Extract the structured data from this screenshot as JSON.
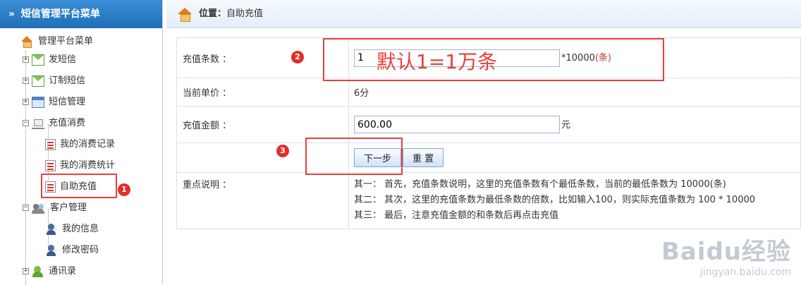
{
  "sidebar": {
    "header": "短信管理平台菜单",
    "chevron": "»",
    "root": "管理平台菜单",
    "items": [
      {
        "label": "发短信",
        "icon": "mail-icon",
        "toggle": "+"
      },
      {
        "label": "订制短信",
        "icon": "mail-icon",
        "toggle": "+"
      },
      {
        "label": "短信管理",
        "icon": "calendar-icon",
        "toggle": "+"
      },
      {
        "label": "充值消费",
        "icon": "cart-icon",
        "toggle": "−",
        "children": [
          {
            "label": "我的消费记录",
            "icon": "list-icon"
          },
          {
            "label": "我的消费统计",
            "icon": "list-icon"
          },
          {
            "label": "自助充值",
            "icon": "list-icon"
          }
        ]
      },
      {
        "label": "客户管理",
        "icon": "users-icon",
        "toggle": "−",
        "children": [
          {
            "label": "我的信息",
            "icon": "person-icon"
          },
          {
            "label": "修改密码",
            "icon": "person-icon"
          }
        ]
      },
      {
        "label": "通讯录",
        "icon": "contacts-icon",
        "toggle": "+"
      }
    ]
  },
  "topbar": {
    "location_label": "位置：",
    "location_value": "自助充值"
  },
  "form": {
    "recharge_count_label": "充值条数 ：",
    "recharge_count_value": "1",
    "recharge_count_unit": "*10000",
    "recharge_count_unit_suffix": "(条)",
    "unit_price_label": "当前单价 ：",
    "unit_price_value": "6分",
    "amount_label": "充值金额 ：",
    "amount_value": "600.00",
    "amount_unit": "元",
    "next_button": "下一步",
    "reset_button": "重 置",
    "notes_label": "重点说明 ：",
    "notes": [
      "其一： 首先，充值条数说明，这里的充值条数有个最低条数，当前的最低条数为 10000(条)",
      "其二： 其次，这里的充值条数为最低条数的倍数，比如输入100，则实际充值条数为 100 * 10000",
      "其三： 最后，注意充值金额的和条数后再点击充值"
    ]
  },
  "annotations": {
    "overlay_text": "默认1=1万条",
    "badges": [
      "1",
      "2",
      "3"
    ],
    "highlight_color": "#e8403a"
  },
  "watermark": {
    "logo": "Baidu经验",
    "url": "jingyan.baidu.com"
  },
  "colors": {
    "header_blue": "#1f6fb8",
    "accent_red": "#e0302c"
  }
}
